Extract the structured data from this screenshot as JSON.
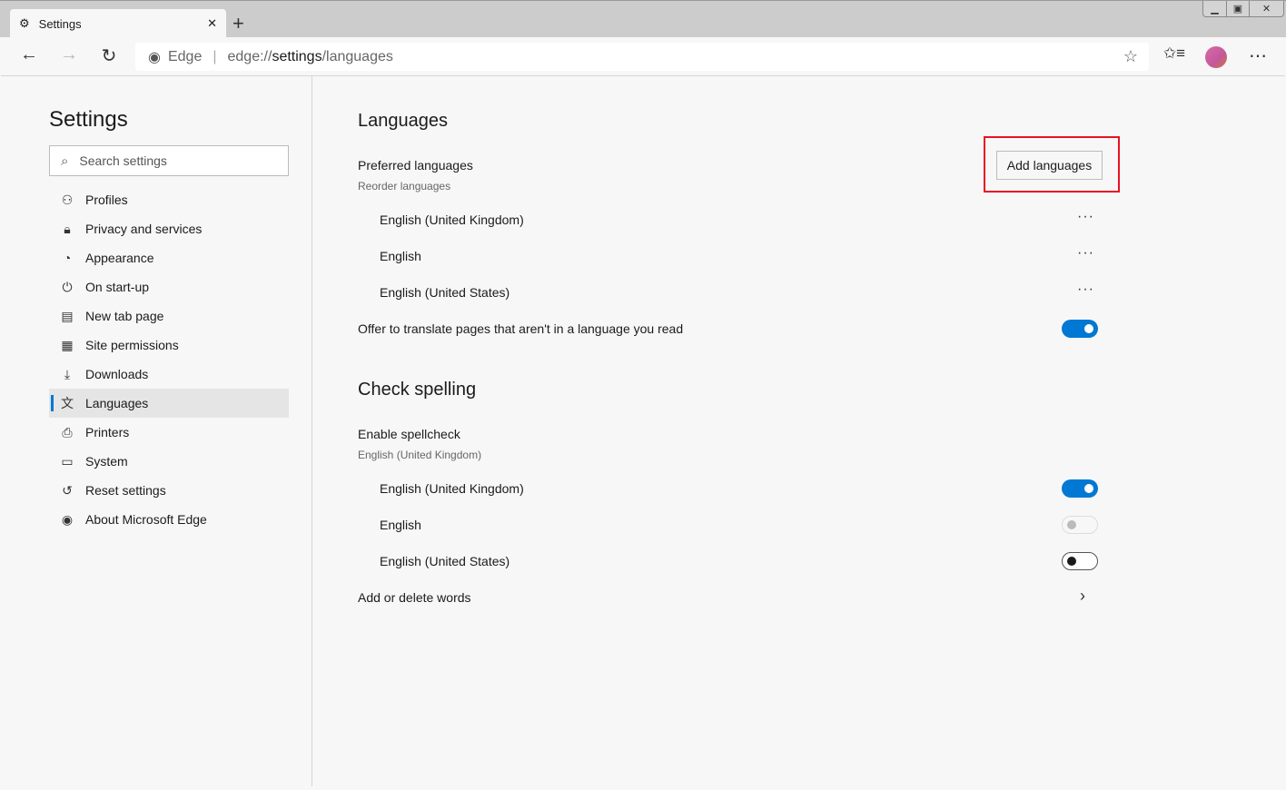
{
  "browser": {
    "tab_title": "Settings",
    "address_prefix": "Edge",
    "url_scheme": "edge://",
    "url_host": "settings",
    "url_path": "/languages",
    "window_controls": [
      "minimize",
      "maximize",
      "close"
    ]
  },
  "sidebar": {
    "title": "Settings",
    "search_placeholder": "Search settings",
    "items": [
      {
        "label": "Profiles",
        "icon": "person-icon",
        "glyph": "⚇"
      },
      {
        "label": "Privacy and services",
        "icon": "lock-icon",
        "glyph": "🔒︎"
      },
      {
        "label": "Appearance",
        "icon": "palette-icon",
        "glyph": "◔"
      },
      {
        "label": "On start-up",
        "icon": "power-icon",
        "glyph": "⏻"
      },
      {
        "label": "New tab page",
        "icon": "new-tab-icon",
        "glyph": "▤"
      },
      {
        "label": "Site permissions",
        "icon": "site-permissions-icon",
        "glyph": "▦"
      },
      {
        "label": "Downloads",
        "icon": "download-icon",
        "glyph": "⤓"
      },
      {
        "label": "Languages",
        "icon": "languages-icon",
        "glyph": "文",
        "active": true
      },
      {
        "label": "Printers",
        "icon": "printer-icon",
        "glyph": "⎙"
      },
      {
        "label": "System",
        "icon": "laptop-icon",
        "glyph": "▭"
      },
      {
        "label": "Reset settings",
        "icon": "reset-icon",
        "glyph": "↺"
      },
      {
        "label": "About Microsoft Edge",
        "icon": "edge-logo-icon",
        "glyph": "◉"
      }
    ]
  },
  "languages": {
    "title": "Languages",
    "preferred_label": "Preferred languages",
    "preferred_sub": "Reorder languages",
    "add_button": "Add languages",
    "list": [
      "English (United Kingdom)",
      "English",
      "English (United States)"
    ],
    "translate_label": "Offer to translate pages that aren't in a language you read",
    "translate_on": true
  },
  "spelling": {
    "title": "Check spelling",
    "enable_label": "Enable spellcheck",
    "enable_sub": "English (United Kingdom)",
    "list": [
      {
        "label": "English (United Kingdom)",
        "state": "on"
      },
      {
        "label": "English",
        "state": "disabled"
      },
      {
        "label": "English (United States)",
        "state": "off"
      }
    ],
    "words_label": "Add or delete words"
  },
  "colors": {
    "accent": "#0078d4",
    "highlight": "#e81123"
  }
}
